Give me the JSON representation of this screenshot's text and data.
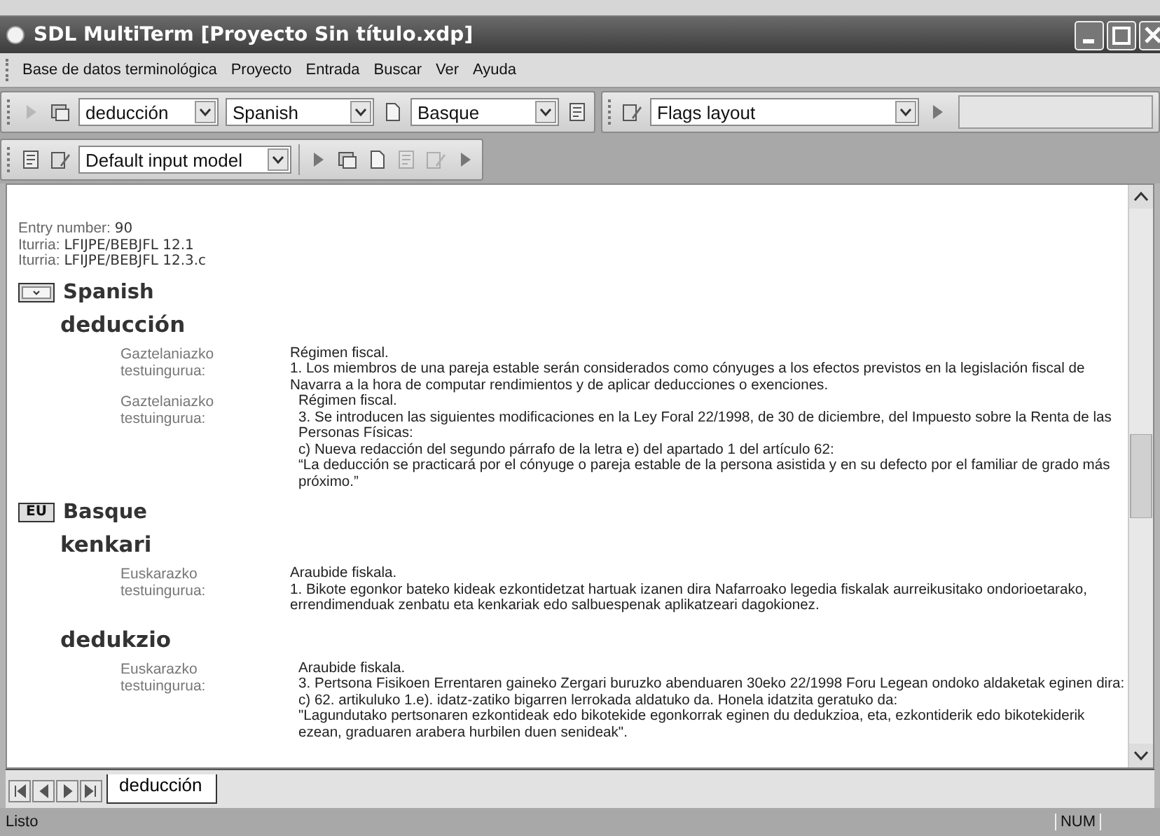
{
  "window": {
    "title": "SDL MultiTerm [Proyecto Sin título.xdp]"
  },
  "menu": [
    "Base de datos terminológica",
    "Proyecto",
    "Entrada",
    "Buscar",
    "Ver",
    "Ayuda"
  ],
  "toolbar_1": [
    {
      "kind": "icon",
      "disabled": true
    },
    {
      "kind": "icon",
      "disabled": false
    },
    {
      "kind": "combo",
      "value": "deducción"
    },
    {
      "kind": "combo",
      "value": "Spanish"
    },
    {
      "kind": "icon",
      "disabled": false
    },
    {
      "kind": "combo",
      "value": "Basque"
    },
    {
      "kind": "icon",
      "disabled": false
    },
    {
      "kind": "separator"
    },
    {
      "kind": "icon",
      "disabled": false
    },
    {
      "kind": "combo",
      "value": "Flags layout"
    },
    {
      "kind": "icon",
      "disabled": false
    },
    {
      "kind": "field"
    }
  ],
  "toolbar_2": [
    {
      "kind": "icon",
      "disabled": false
    },
    {
      "kind": "icon",
      "disabled": false
    },
    {
      "kind": "combo",
      "value": "Default input model"
    },
    {
      "kind": "separator"
    },
    {
      "kind": "icon",
      "disabled": false
    },
    {
      "kind": "icon",
      "disabled": false
    },
    {
      "kind": "icon",
      "disabled": false
    },
    {
      "kind": "icon",
      "disabled": true
    },
    {
      "kind": "icon",
      "disabled": true
    },
    {
      "kind": "icon",
      "disabled": false
    }
  ],
  "entry": {
    "fields": [
      {
        "label": "Entry number:",
        "value": "90"
      },
      {
        "label": "Iturria:",
        "value": "LFIJPE/BEBJFL 12.1"
      },
      {
        "label": "Iturria:",
        "value": "LFIJPE/BEBJFL 12.3.c"
      }
    ],
    "languages": [
      {
        "name": "Spanish",
        "flag": {
          "kind": "dropdown"
        },
        "terms": [
          {
            "term": "deducción",
            "contexts": [
              {
                "label": [
                  "Gaztelaniazko",
                  "testuingurua:"
                ],
                "indented": false,
                "lines": [
                  "Régimen fiscal.",
                  "1. Los miembros de una pareja estable serán considerados como cónyuges a los efectos previstos en la legislación fiscal de Navarra a la hora de computar rendimientos y de aplicar deducciones o exenciones."
                ]
              },
              {
                "label": [
                  "Gaztelaniazko",
                  "testuingurua:"
                ],
                "indented": true,
                "lines": [
                  "Régimen fiscal.",
                  "3. Se introducen las siguientes modificaciones en la Ley Foral 22/1998, de 30 de diciembre, del Impuesto sobre la Renta de las Personas Físicas:",
                  "c) Nueva redacción del segundo párrafo de la letra e) del apartado 1 del artículo 62:",
                  "“La deducción se practicará por el cónyuge o pareja estable de la persona asistida y en su defecto por el familiar de grado más próximo.”"
                ]
              }
            ]
          }
        ]
      },
      {
        "name": "Basque",
        "flag": {
          "kind": "text",
          "text": "EU"
        },
        "terms": [
          {
            "term": "kenkari",
            "contexts": [
              {
                "label": [
                  "Euskarazko",
                  "testuingurua:"
                ],
                "indented": false,
                "lines": [
                  "Araubide fiskala.",
                  "1. Bikote egonkor bateko kideak ezkontidetzat hartuak izanen dira Nafarroako legedia fiskalak aurreikusitako ondorioetarako, errendimenduak zenbatu eta kenkariak edo salbuespenak aplikatzeari dagokionez."
                ]
              }
            ]
          },
          {
            "term": "dedukzio",
            "contexts": [
              {
                "label": [
                  "Euskarazko",
                  "testuingurua:"
                ],
                "indented": true,
                "lines": [
                  "Araubide fiskala.",
                  "3. Pertsona Fisikoen Errentaren gaineko Zergari buruzko abenduaren 30eko 22/1998 Foru Legean ondoko aldaketak eginen dira:",
                  "c) 62. artikuluko 1.e). idatz-zatiko bigarren lerrokada aldatuko da. Honela idatzita geratuko da:",
                  "\"Lagundutako pertsonaren ezkontideak edo bikotekide egonkorrak eginen du dedukzioa, eta, ezkontiderik edo bikotekiderik ezean, graduaren arabera hurbilen duen senideak\"."
                ]
              }
            ]
          }
        ]
      }
    ]
  },
  "tabs": [
    {
      "label": "deducción",
      "selected": true
    }
  ],
  "status_bar": {
    "text": "Listo",
    "indicator": "NUM"
  }
}
